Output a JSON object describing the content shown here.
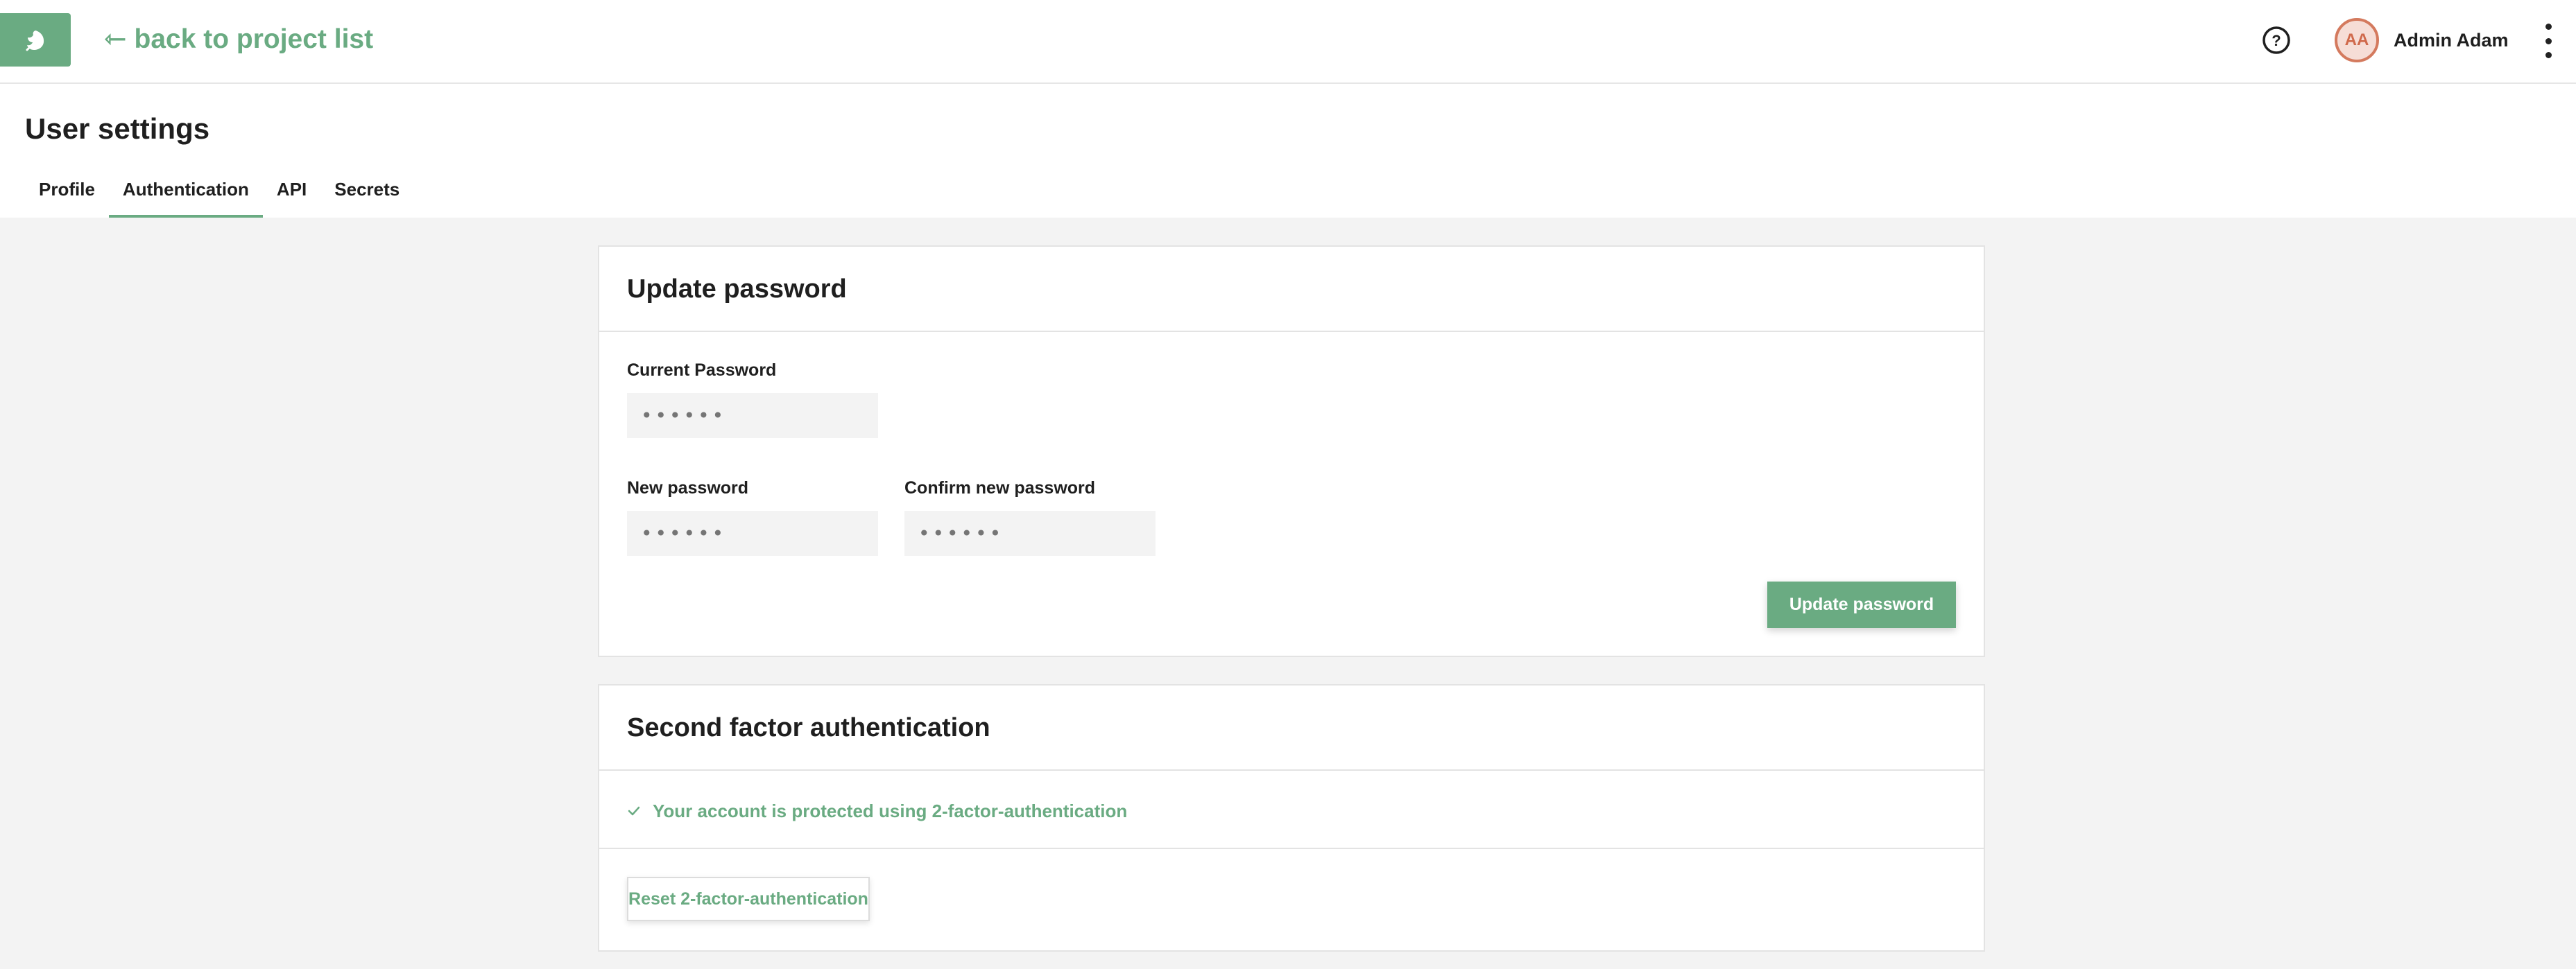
{
  "topbar": {
    "logo_icon": "hop-leaf-icon",
    "back_label": "⇽ back to project list",
    "help_icon": "help-circle-icon",
    "user": {
      "initials": "AA",
      "name": "Admin Adam"
    },
    "menu_icon": "kebab-menu-icon"
  },
  "page": {
    "title": "User settings",
    "tabs": [
      {
        "label": "Profile",
        "active": false
      },
      {
        "label": "Authentication",
        "active": true
      },
      {
        "label": "API",
        "active": false
      },
      {
        "label": "Secrets",
        "active": false
      }
    ]
  },
  "update_password": {
    "title": "Update password",
    "current_label": "Current Password",
    "current_placeholder": "••••••",
    "new_label": "New password",
    "new_placeholder": "••••••",
    "confirm_label": "Confirm new password",
    "confirm_placeholder": "••••••",
    "submit_label": "Update password"
  },
  "two_factor": {
    "title": "Second factor authentication",
    "status_text": "Your account is protected using 2-factor-authentication",
    "reset_label": "Reset 2-factor-authentication"
  },
  "colors": {
    "accent": "#6aab82",
    "avatar_border": "#d47a5e",
    "avatar_bg": "#f6ddd6",
    "background": "#f3f3f3"
  }
}
